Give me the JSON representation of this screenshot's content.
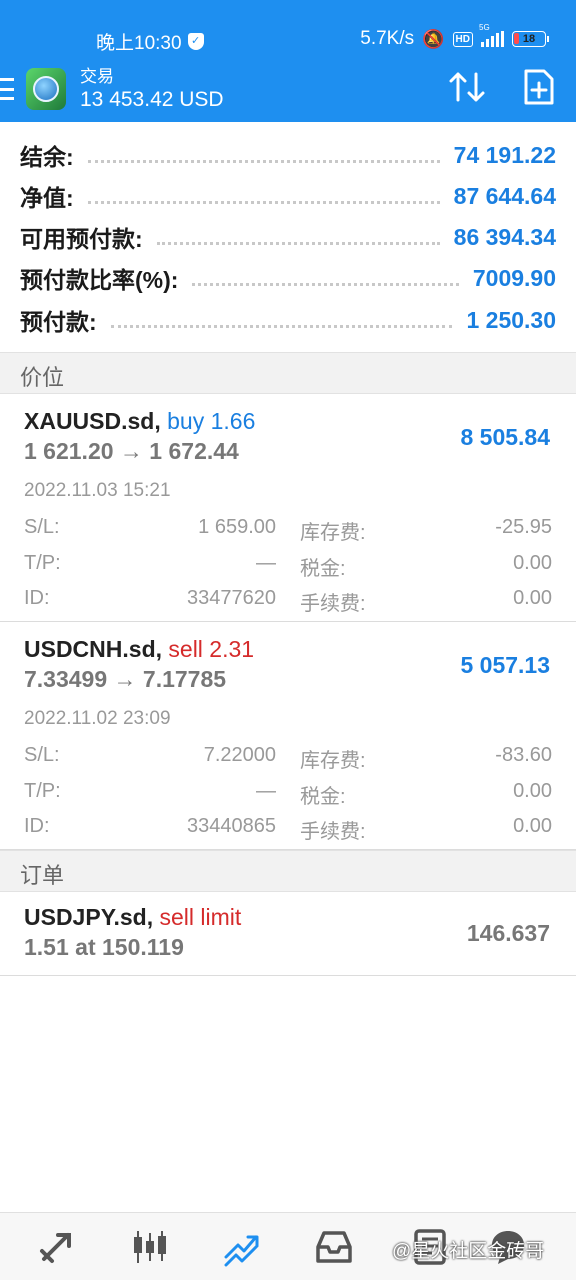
{
  "status_bar": {
    "time": "晚上10:30",
    "net_speed": "5.7K/s",
    "hd_badge": "HD",
    "network_type": "5G",
    "battery": "18",
    "battery_color": "#ff4d4f"
  },
  "app_bar": {
    "title": "交易",
    "balance": "13 453.42 USD",
    "icons": [
      "menu-icon",
      "app-logo",
      "sort-icon",
      "new-order-icon"
    ]
  },
  "summary": [
    {
      "label": "结余:",
      "value": "74 191.22"
    },
    {
      "label": "净值:",
      "value": "87 644.64"
    },
    {
      "label": "可用预付款:",
      "value": "86 394.34"
    },
    {
      "label": "预付款比率(%):",
      "value": "7009.90"
    },
    {
      "label": "预付款:",
      "value": "1 250.30"
    }
  ],
  "sections": {
    "positions": "价位",
    "orders": "订单"
  },
  "positions": [
    {
      "symbol": "XAUUSD.sd,",
      "side": "buy 1.66",
      "prices": "1 621.20 → 1 672.44",
      "profit": "8 505.84",
      "date": "2022.11.03 15:21",
      "sl_label": "S/L:",
      "sl": "1 659.00",
      "tp_label": "T/P:",
      "tp": "—",
      "id_label": "ID:",
      "id": "33477620",
      "swap_label": "库存费:",
      "swap": "-25.95",
      "tax_label": "税金:",
      "tax": "0.00",
      "fee_label": "手续费:",
      "fee": "0.00"
    },
    {
      "symbol": "USDCNH.sd,",
      "side": "sell 2.31",
      "prices": "7.33499 → 7.17785",
      "profit": "5 057.13",
      "date": "2022.11.02 23:09",
      "sl_label": "S/L:",
      "sl": "7.22000",
      "tp_label": "T/P:",
      "tp": "—",
      "id_label": "ID:",
      "id": "33440865",
      "swap_label": "库存费:",
      "swap": "-83.60",
      "tax_label": "税金:",
      "tax": "0.00",
      "fee_label": "手续费:",
      "fee": "0.00"
    }
  ],
  "orders": [
    {
      "symbol": "USDJPY.sd,",
      "type": "sell limit",
      "detail": "1.51 at 150.119",
      "price": "146.637"
    }
  ],
  "bottom_nav": [
    "quotes-icon",
    "chart-icon",
    "trade-icon",
    "history-icon",
    "news-icon",
    "chat-icon"
  ],
  "watermark": "@星火社区金砖哥",
  "colors": {
    "header": "#1e8ff0",
    "accent": "#1a7fe0",
    "sell": "#d52b2b"
  }
}
